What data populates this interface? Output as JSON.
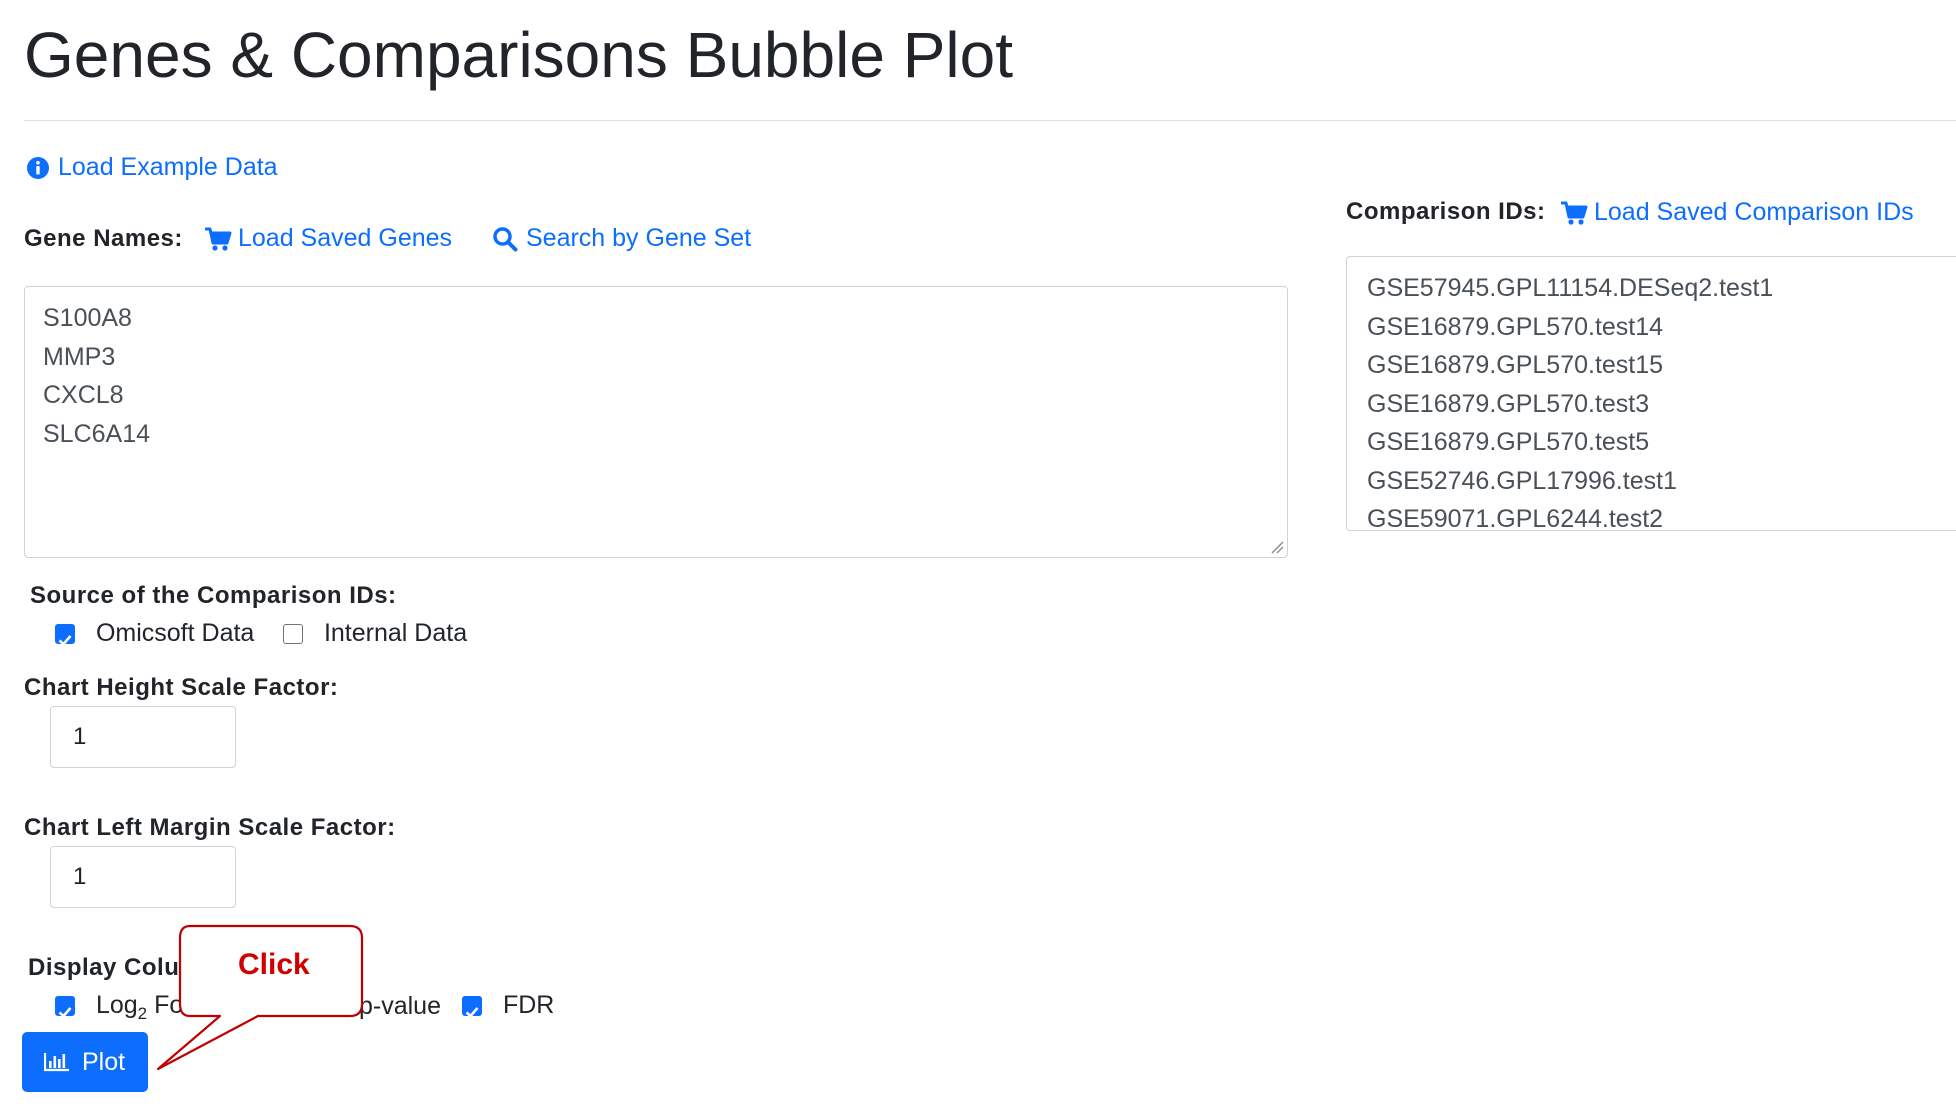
{
  "page": {
    "title": "Genes & Comparisons Bubble Plot"
  },
  "links": {
    "load_example": "Load Example Data",
    "load_saved_genes": "Load Saved Genes",
    "search_gene_set": "Search by Gene Set",
    "load_saved_comparisons": "Load Saved Comparison IDs"
  },
  "icons": {
    "info": "info-circle-icon",
    "cart": "cart-icon",
    "search": "search-icon",
    "chart": "bar-chart-icon",
    "resize": "resize-grip-icon"
  },
  "gene_names": {
    "label": "Gene Names:",
    "values": [
      "S100A8",
      "MMP3",
      "CXCL8",
      "SLC6A14"
    ]
  },
  "comparison_ids": {
    "label": "Comparison IDs:",
    "values": [
      "GSE57945.GPL11154.DESeq2.test1",
      "GSE16879.GPL570.test14",
      "GSE16879.GPL570.test15",
      "GSE16879.GPL570.test3",
      "GSE16879.GPL570.test5",
      "GSE52746.GPL17996.test1",
      "GSE59071.GPL6244.test2"
    ]
  },
  "source": {
    "label": "Source of the Comparison IDs:",
    "options": [
      {
        "label": "Omicsoft Data",
        "checked": true
      },
      {
        "label": "Internal Data",
        "checked": false
      }
    ]
  },
  "height_scale": {
    "label": "Chart Height Scale Factor:",
    "value": "1"
  },
  "margin_scale": {
    "label": "Chart Left Margin Scale Factor:",
    "value": "1"
  },
  "display_columns": {
    "label_visible": "Display Colu",
    "options": [
      {
        "label_visible": "Log",
        "sub": "2",
        "suffix": " Fo",
        "checked": true
      },
      {
        "label_visible": "p-value",
        "checked": true
      },
      {
        "label": "FDR",
        "checked": true
      }
    ]
  },
  "plot_button": {
    "label": "Plot"
  },
  "callout": {
    "text": "Click"
  },
  "colors": {
    "primary": "#0d6efd",
    "callout_border": "#c00000",
    "callout_text": "#d00000",
    "text": "#212529"
  }
}
